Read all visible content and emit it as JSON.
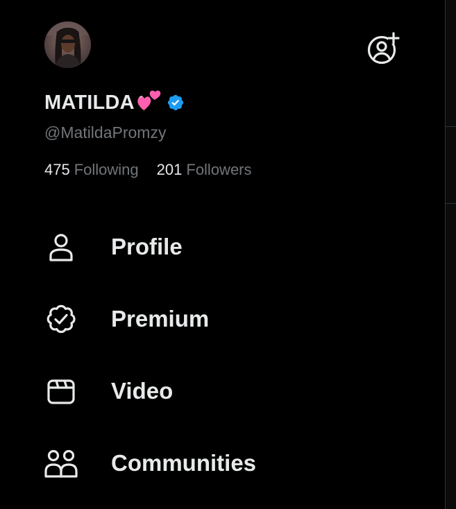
{
  "profile": {
    "display_name": "MATILDA",
    "name_emoji": "two-hearts-emoji",
    "verified": true,
    "verified_color": "#1d9bf0",
    "handle": "@MatildaPromzy"
  },
  "stats": {
    "following_count": "475",
    "following_label": "Following",
    "followers_count": "201",
    "followers_label": "Followers"
  },
  "menu": {
    "items": [
      {
        "label": "Profile",
        "icon": "person-icon"
      },
      {
        "label": "Premium",
        "icon": "verified-badge-icon"
      },
      {
        "label": "Video",
        "icon": "video-clapper-icon"
      },
      {
        "label": "Communities",
        "icon": "communities-icon"
      }
    ]
  },
  "colors": {
    "background": "#000000",
    "primary_text": "#e7e9ea",
    "secondary_text": "#71767b",
    "emoji_pink": "#ff5fae"
  }
}
